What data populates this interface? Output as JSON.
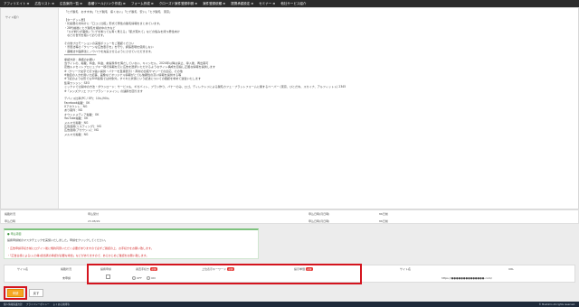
{
  "topnav": {
    "items": [
      "アフィリエイト ≡",
      "広告リスト ≡",
      "広告案内一覧 ≡",
      "各種ツール(リンク作成) ≡",
      "フォーム作成 ≡",
      "クローズド案件登録申請 ≡",
      "案件登録依頼 ≡",
      "提携承認設定 ≡",
      "セミナー ≡",
      "他社サービス紹介"
    ]
  },
  "content": {
    "left_label": "サイト紹介",
    "lines": [
      "「ヒゲ脱毛　おすすめ」「ヒゲ脱毛　痛くない」「ヒゲ脱毛　安い」「ヒゲ脱毛　東京」",
      "",
      "【ターゲット層】",
      "・忙殺層の方向けに「口コミ比較」形式で男性の脱毛情報をまとめています。",
      "・28代前後にヒゲ脱毛を検討中の方など",
      "　「ひげ剃りが面倒」「ヒゲを剃っても青く見える」「肌が荒れて」などの悩みを持つ男性向け",
      "　などの世代を抱いております。",
      "",
      "その他プロモーションの実施ポリシーをご確認ください",
      "・景表法等の「クリーンな広告表示を」を守り、誇張表現を使用しない",
      "・薬機法や医師法とノウハウを充実させるようにさせていただきます。",
      "━━━━━━━━━━━━━━━━━━━",
      "承認方針：承諾のお願い",
      "当サイトの、掲載、料金、料金、前提条件を満たしていない、キャンセル、2024年以降は禁止、導入後、再出案可",
      "定数ルドセイトプロミュブキー移行情報を元に広告を選択いただけるようなサイト構成を目指し正確な情報を提供します",
      "※（クリーク文字で打つ強い提供・バナーを直接表示）・商材の比較サマリーでの反応、その他",
      "※独自の入力を用いた記事、画像などオリジナル情報がとても信頼性の高い情報を提供する等",
      "※下記のような形でもSNS投稿では対象外。すぐれた状態という記述についての確認を求めて運営いたします",
      "集客ワンジン：SEO",
      "ミックドで公開中の方法・ダウンロード：サービスも、ギガバイト、プラン作り、バナーのみ、ロゴ、ディレクトリによる脱毛カフェ・プラットフォームに関するペーパー (東京、ひとだね、スカイナ、アルフィットト) 2345",
      "※「メンズクリエ フリープラン・ドメイン」の連携を図ります",
      "",
      "デバイス比率(PC / SP)：10％/90％",
      "Facebook掲載：OK",
      "Xアカウント：NG",
      "あり案件：NG",
      "オウンドメディア掲載：OK",
      "YouTube掲載：OK",
      "メルマガ掲載：NG",
      "広告運用(リスティング)：NG",
      "広告運用(アカウント)：NG",
      "メルマガ掲載：NG"
    ]
  },
  "metrics": {
    "row1": {
      "label1": "掲載状況",
      "value1": "申込受付",
      "label2": "申込日時(月日時)",
      "value2": "86日前"
    },
    "row2": {
      "label1": "申込日時",
      "value1": "23.08/29",
      "label2": "申込日時(月日時)",
      "value2": "86日前"
    }
  },
  "notice": {
    "title": "● 申込項目",
    "line1": "提携申請前のマスタチェックを実施いたしました。申請をクリックしてください。",
    "line2": "・広告申請手続き前にログイン後に規約同意いただく必要がありますので必ずご確認の上、お手続きをお願い致します。",
    "line3": "・「広告主様による(入力等)担当者の承認が必要な場合」などがありますので、あらかじめご確認をお願い致します。"
  },
  "table": {
    "headers": [
      "サイト名",
      "掲載状況",
      "提携申請",
      "審査手続き",
      "上位表示キーワード",
      "提示単価",
      "サイト名",
      "URL"
    ],
    "required_badge": "必須",
    "row": {
      "status": "未申請",
      "radio_off": "OFF",
      "radio_on": "ON",
      "url": "https://●●●●●●●●●●●●●●.com/"
    }
  },
  "buttons": {
    "save": "申請",
    "back": "戻す"
  },
  "footer": {
    "links": [
      "個人情報保護方針",
      "プライバシーポリシー",
      "よくある質問等"
    ],
    "copyright": "© Moshimo All rights reserved."
  }
}
